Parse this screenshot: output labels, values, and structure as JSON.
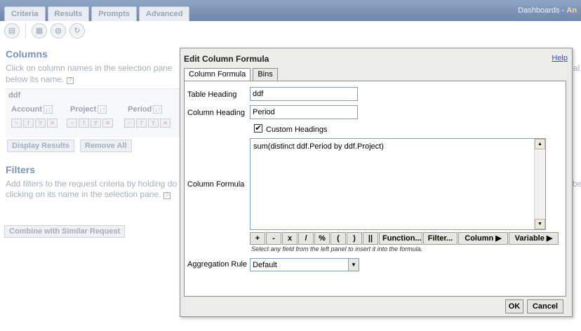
{
  "background": {
    "tabs": [
      "Criteria",
      "Results",
      "Prompts",
      "Advanced"
    ],
    "top_right": "Dashboards -",
    "top_right_user": "An",
    "toolbar_icons": [
      "save-icon",
      "table-view-icon",
      "pivot-view-icon",
      "refresh-icon"
    ],
    "columns": {
      "heading": "Columns",
      "text_line1": "Click on column names in the selection pane",
      "text_line2": "below its name.",
      "ddf_label": "ddf",
      "groups": [
        {
          "name": "Account"
        },
        {
          "name": "Project"
        },
        {
          "name": "Period"
        }
      ],
      "display_results": "Display Results",
      "remove_all": "Remove All"
    },
    "filters": {
      "heading": "Filters",
      "text_line1": "Add filters to the request criteria by holding do",
      "text_line2": "clicking on its name in the selection pane.",
      "right_frag1": "al,",
      "right_frag2": "be"
    },
    "combine": "Combine with Similar Request"
  },
  "dialog": {
    "title": "Edit Column Formula",
    "help": "Help",
    "tabs": [
      "Column Formula",
      "Bins"
    ],
    "table_heading_label": "Table Heading",
    "table_heading_value": "ddf",
    "column_heading_label": "Column Heading",
    "column_heading_value": "Period",
    "custom_headings_label": "Custom Headings",
    "custom_headings_checked": "✔",
    "column_formula_label": "Column Formula",
    "formula_value": "sum(distinct ddf.Period by ddf.Project)",
    "formula_buttons": [
      "+",
      "-",
      "x",
      "/",
      "%",
      "(",
      ")",
      "||",
      "Function...",
      "Filter...",
      "Column ▶",
      "Variable ▶"
    ],
    "hint": "Select any field from the left panel to insert it into the formula.",
    "aggregation_label": "Aggregation Rule",
    "aggregation_value": "Default",
    "ok": "OK",
    "cancel": "Cancel"
  }
}
